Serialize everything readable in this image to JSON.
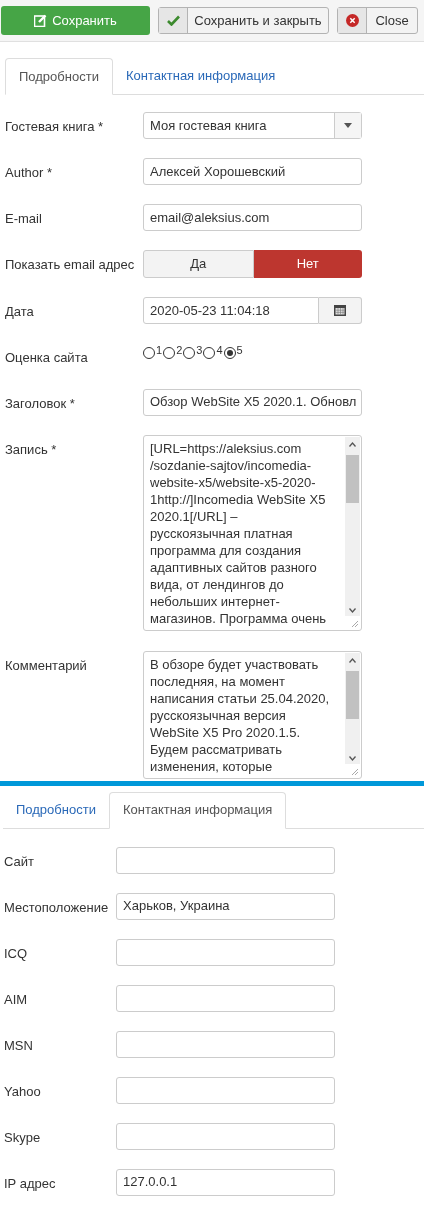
{
  "toolbar": [
    {
      "kind": "save",
      "label": "Сохранить"
    },
    {
      "kind": "save_close",
      "label": "Сохранить и закрыть"
    },
    {
      "kind": "close",
      "label": "Close"
    }
  ],
  "details": {
    "tabs": [
      {
        "label": "Подробности",
        "selected": true
      },
      {
        "label": "Контактная информация",
        "selected": false
      }
    ],
    "fields": [
      {
        "kind": "select",
        "label": "Гостевая книга *",
        "value": "Моя гостевая книга"
      },
      {
        "kind": "text",
        "label": "Author *",
        "value": "Алексей Хорошевский"
      },
      {
        "kind": "text",
        "label": "E-mail",
        "value": "email@aleksius.com"
      },
      {
        "kind": "toggle",
        "label": "Показать email адрес",
        "options": [
          {
            "label": "Да",
            "selected": false
          },
          {
            "label": "Нет",
            "selected": true
          }
        ]
      },
      {
        "kind": "date",
        "label": "Дата",
        "value": "2020-05-23 11:04:18"
      },
      {
        "kind": "radio",
        "label": "Оценка сайта",
        "options": [
          {
            "label": "1",
            "selected": false
          },
          {
            "label": "2",
            "selected": false
          },
          {
            "label": "3",
            "selected": false
          },
          {
            "label": "4",
            "selected": false
          },
          {
            "label": "5",
            "selected": true
          }
        ]
      },
      {
        "kind": "text",
        "label": "Заголовок *",
        "value": "Обзор WebSite X5 2020.1. Обновл"
      },
      {
        "kind": "textarea",
        "label": "Запись *",
        "value": "[URL=https://aleksius.com /sozdanie-sajtov/incomedia-website-x5/website-x5-2020-1http://]Incomedia WebSite X5 2020.1[/URL] – русскоязычная платная программа для создания адаптивных сайтов разного вида, от лендингов до небольших интернет-магазинов. Программа очень"
      },
      {
        "kind": "textarea",
        "label": "Комментарий",
        "value": "В обзоре будет участвовать последняя, на момент написания статьи 25.04.2020, русскоязычная версия WebSite X5 Pro 2020.1.5. Будем рассматривать изменения, которые"
      }
    ]
  },
  "contact": {
    "tabs": [
      {
        "label": "Подробности",
        "selected": false
      },
      {
        "label": "Контактная информация",
        "selected": true
      }
    ],
    "fields": [
      {
        "kind": "text",
        "label": "Сайт"
      },
      {
        "kind": "text",
        "label": "Местоположение",
        "value": "Харьков, Украина"
      },
      {
        "kind": "text",
        "label": "ICQ"
      },
      {
        "kind": "text",
        "label": "AIM"
      },
      {
        "kind": "text",
        "label": "MSN"
      },
      {
        "kind": "text",
        "label": "Yahoo"
      },
      {
        "kind": "text",
        "label": "Skype"
      },
      {
        "kind": "text",
        "label": "IP адрес",
        "value": "127.0.0.1"
      }
    ]
  }
}
